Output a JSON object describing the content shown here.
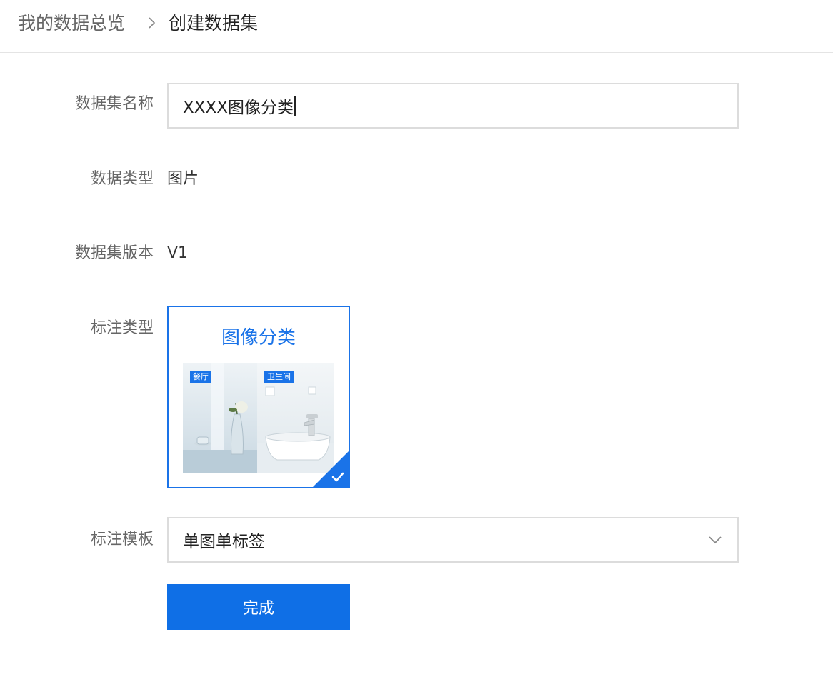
{
  "breadcrumb": {
    "root": "我的数据总览",
    "separator_icon": "chevron-right-icon",
    "current": "创建数据集"
  },
  "form": {
    "dataset_name": {
      "label": "数据集名称",
      "value": "XXXX图像分类"
    },
    "data_type": {
      "label": "数据类型",
      "value": "图片"
    },
    "dataset_version": {
      "label": "数据集版本",
      "value": "V1"
    },
    "annotation_type": {
      "label": "标注类型",
      "selected_option": {
        "title": "图像分类",
        "tags": [
          "餐厅",
          "卫生间"
        ],
        "check_icon": "checkmark-icon"
      }
    },
    "annotation_template": {
      "label": "标注模板",
      "value": "单图单标签",
      "icon": "chevron-down-icon"
    },
    "submit_label": "完成"
  },
  "colors": {
    "accent": "#1a73e8",
    "button": "#0f6fe6",
    "border": "#dcdcdc",
    "label_text": "#666666"
  }
}
